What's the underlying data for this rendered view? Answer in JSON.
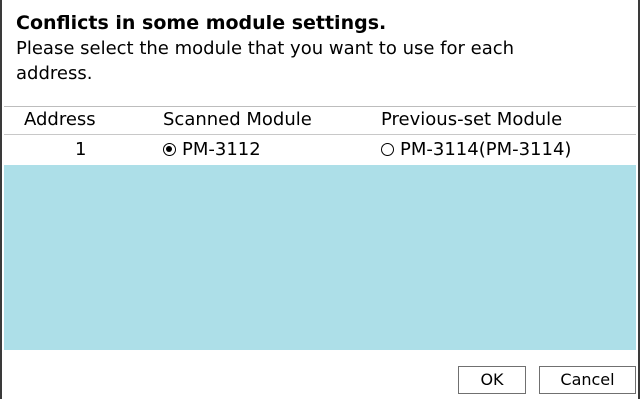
{
  "dialog": {
    "title": "Conflicts in some module settings.",
    "description": "Please select the module that you want to use for each address."
  },
  "table": {
    "columns": [
      "Address",
      "Scanned Module",
      "Previous-set Module"
    ],
    "rows": [
      {
        "address": "1",
        "scanned_module": "PM-3112",
        "scanned_selected": true,
        "previous_module": "PM-3114(PM-3114)",
        "previous_selected": false
      }
    ],
    "empty_area_color": "#addfe8"
  },
  "buttons": {
    "ok_label": "OK",
    "cancel_label": "Cancel"
  }
}
